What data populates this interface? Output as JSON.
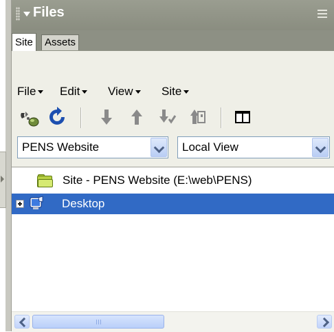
{
  "panel": {
    "title": "Files",
    "tabs": [
      {
        "label": "Site",
        "active": true
      },
      {
        "label": "Assets",
        "active": false
      }
    ]
  },
  "menubar": {
    "items": [
      {
        "label": "File"
      },
      {
        "label": "Edit"
      },
      {
        "label": "View"
      },
      {
        "label": "Site"
      }
    ]
  },
  "toolbar": {
    "icons": [
      "connect-icon",
      "refresh-icon",
      "get-icon",
      "put-icon",
      "check-out-icon",
      "check-in-icon",
      "expand-collapse-icon"
    ]
  },
  "selects": {
    "site": "PENS Website",
    "view": "Local View"
  },
  "tree": {
    "rows": [
      {
        "label": "Site - PENS Website (E:\\web\\PENS)",
        "selected": false
      },
      {
        "label": "Desktop",
        "selected": true
      }
    ]
  },
  "scrollbar": {
    "position": 0
  },
  "colors": {
    "titlebar": "#8d9084",
    "selection": "#316ac5",
    "panel_bg": "#efefe7"
  }
}
